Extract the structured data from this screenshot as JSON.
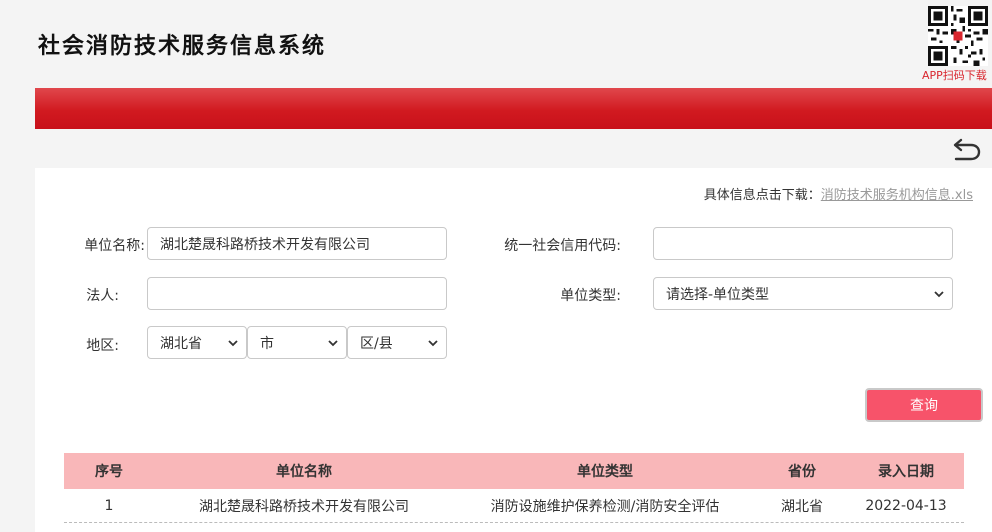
{
  "header": {
    "title": "社会消防技术服务信息系统",
    "qr_caption": "APP扫码下载"
  },
  "colors": {
    "brand_red": "#d11a20",
    "button": "#f7536a",
    "table_header": "#f9b7b9",
    "link": "#999999"
  },
  "download": {
    "prompt": "具体信息点击下载：",
    "file_link": "消防技术服务机构信息.xls"
  },
  "form": {
    "unit_name_label": "单位名称:",
    "unit_name_value": "湖北楚晟科路桥技术开发有限公司",
    "credit_code_label": "统一社会信用代码:",
    "credit_code_value": "",
    "legal_person_label": "法人:",
    "legal_person_value": "",
    "unit_type_label": "单位类型:",
    "unit_type_selected": "请选择-单位类型",
    "region_label": "地区:",
    "province_selected": "湖北省",
    "city_selected": "市",
    "district_selected": "区/县",
    "query_button": "查询"
  },
  "table": {
    "columns": [
      "序号",
      "单位名称",
      "单位类型",
      "省份",
      "录入日期"
    ],
    "rows": [
      [
        "1",
        "湖北楚晟科路桥技术开发有限公司",
        "消防设施维护保养检测/消防安全评估",
        "湖北省",
        "2022-04-13"
      ]
    ]
  }
}
